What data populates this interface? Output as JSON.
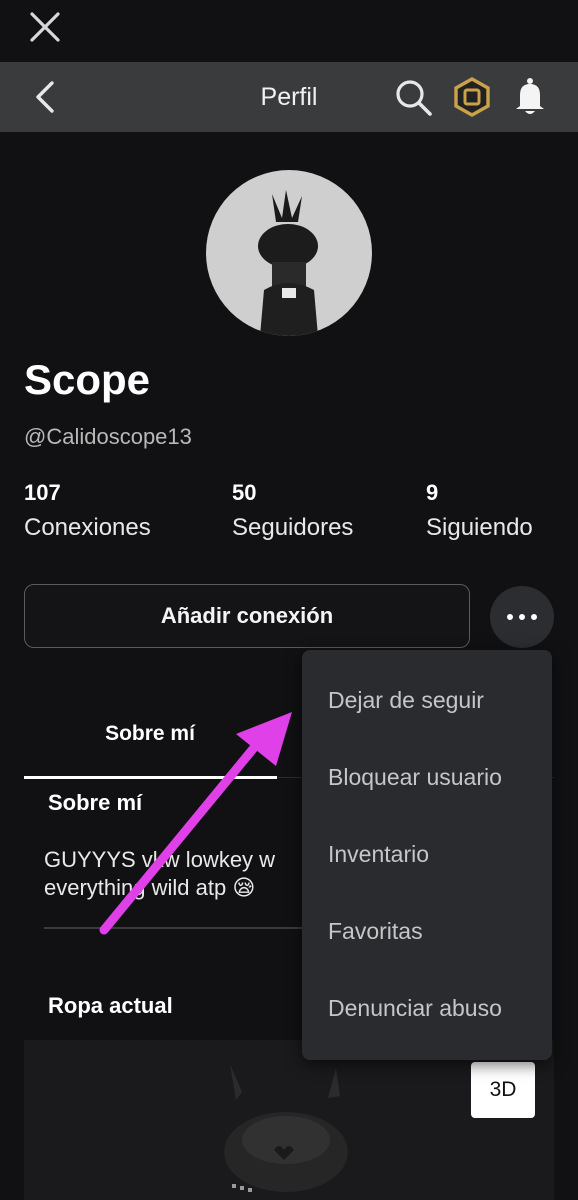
{
  "header": {
    "title": "Perfil",
    "icons": [
      "close-icon",
      "back-chevron-icon",
      "search-icon",
      "robux-icon",
      "bell-icon"
    ]
  },
  "profile": {
    "display_name": "Scope",
    "username": "@Calidoscope13"
  },
  "stats": [
    {
      "value": "107",
      "label": "Conexiones"
    },
    {
      "value": "50",
      "label": "Seguidores"
    },
    {
      "value": "9",
      "label": "Siguiendo"
    }
  ],
  "actions": {
    "add_connection": "Añadir conexión"
  },
  "tabs": {
    "about": "Sobre mí"
  },
  "about": {
    "heading": "Sobre mí",
    "text": "GUYYYS vkw lowkey w\neverything wild atp 😪"
  },
  "outfit": {
    "heading": "Ropa actual",
    "view_3d": "3D"
  },
  "menu": {
    "items": [
      "Dejar de seguir",
      "Bloquear usuario",
      "Inventario",
      "Favoritas",
      "Denunciar abuso"
    ]
  },
  "colors": {
    "background": "#111113",
    "header": "#3a3b3d",
    "menu": "#2a2b2e",
    "annotation_arrow": "#e040e8",
    "robux_gold": "#c9a24a"
  }
}
